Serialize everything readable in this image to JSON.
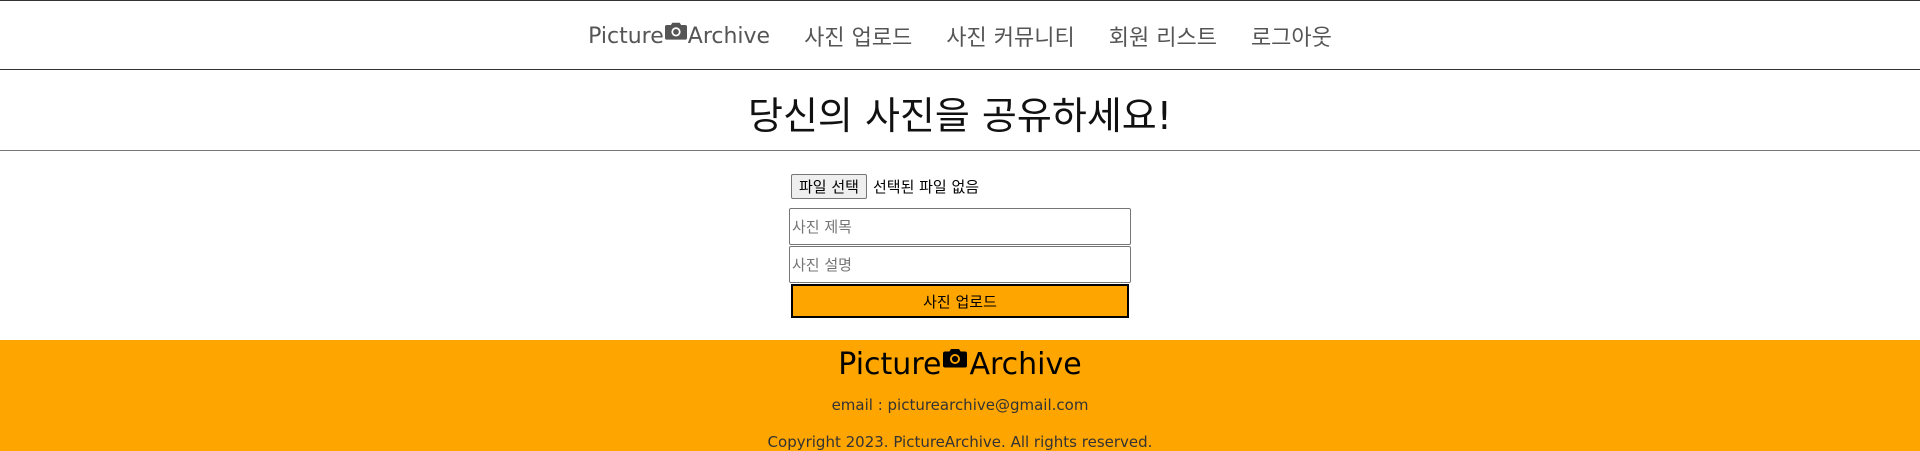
{
  "nav": {
    "brand_left": "Picture",
    "brand_right": "Archive",
    "brand_icon": "camera-icon",
    "items": [
      {
        "label": "사진 업로드"
      },
      {
        "label": "사진 커뮤니티"
      },
      {
        "label": "회원 리스트"
      },
      {
        "label": "로그아웃"
      }
    ]
  },
  "hero": {
    "title": "당신의 사진을 공유하세요!"
  },
  "form": {
    "file_button": "파일 선택",
    "file_status": "선택된 파일 없음",
    "title_placeholder": "사진 제목",
    "title_value": "",
    "desc_placeholder": "사진 설명",
    "desc_value": "",
    "submit_label": "사진 업로드"
  },
  "footer": {
    "brand_left": "Picture",
    "brand_right": "Archive",
    "brand_icon": "camera-icon",
    "email": "email : picturearchive@gmail.com",
    "copyright": "Copyright 2023. PictureArchive. All rights reserved."
  },
  "colors": {
    "accent": "#ffa500",
    "nav_text": "#555555",
    "border": "#333333"
  }
}
